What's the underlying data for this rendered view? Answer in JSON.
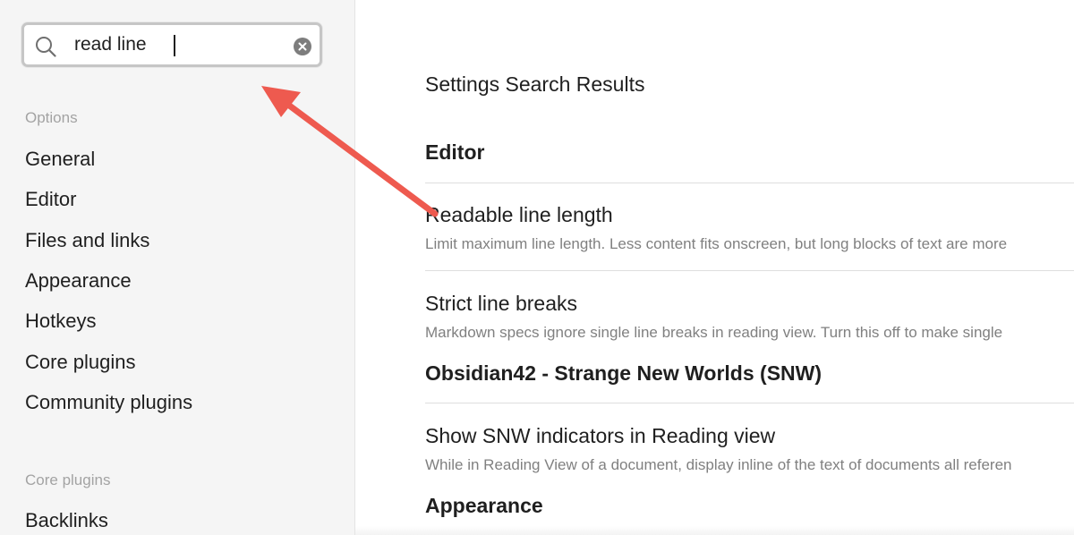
{
  "search": {
    "value": "read line"
  },
  "sidebar": {
    "options_header": "Options",
    "options_items": [
      {
        "label": "General"
      },
      {
        "label": "Editor"
      },
      {
        "label": "Files and links"
      },
      {
        "label": "Appearance"
      },
      {
        "label": "Hotkeys"
      },
      {
        "label": "Core plugins"
      },
      {
        "label": "Community plugins"
      }
    ],
    "core_plugins_header": "Core plugins",
    "core_plugins_items": [
      {
        "label": "Backlinks"
      }
    ]
  },
  "main": {
    "title": "Settings Search Results",
    "groups": [
      {
        "heading": "Editor",
        "settings": [
          {
            "name": "Readable line length",
            "description": "Limit maximum line length. Less content fits onscreen, but long blocks of text are more"
          },
          {
            "name": "Strict line breaks",
            "description": "Markdown specs ignore single line breaks in reading view. Turn this off to make single"
          }
        ]
      },
      {
        "heading": "Obsidian42 - Strange New Worlds (SNW)",
        "settings": [
          {
            "name": "Show SNW indicators in Reading view",
            "description": "While in Reading View of a document, display inline of the text of documents all referen"
          }
        ]
      },
      {
        "heading": "Appearance",
        "settings": []
      }
    ]
  },
  "colors": {
    "annotation_arrow": "#ee5a4f",
    "sidebar_bg": "#f5f5f5",
    "muted_text": "#808080"
  },
  "icons": {
    "search": "search-icon",
    "clear": "clear-icon"
  }
}
